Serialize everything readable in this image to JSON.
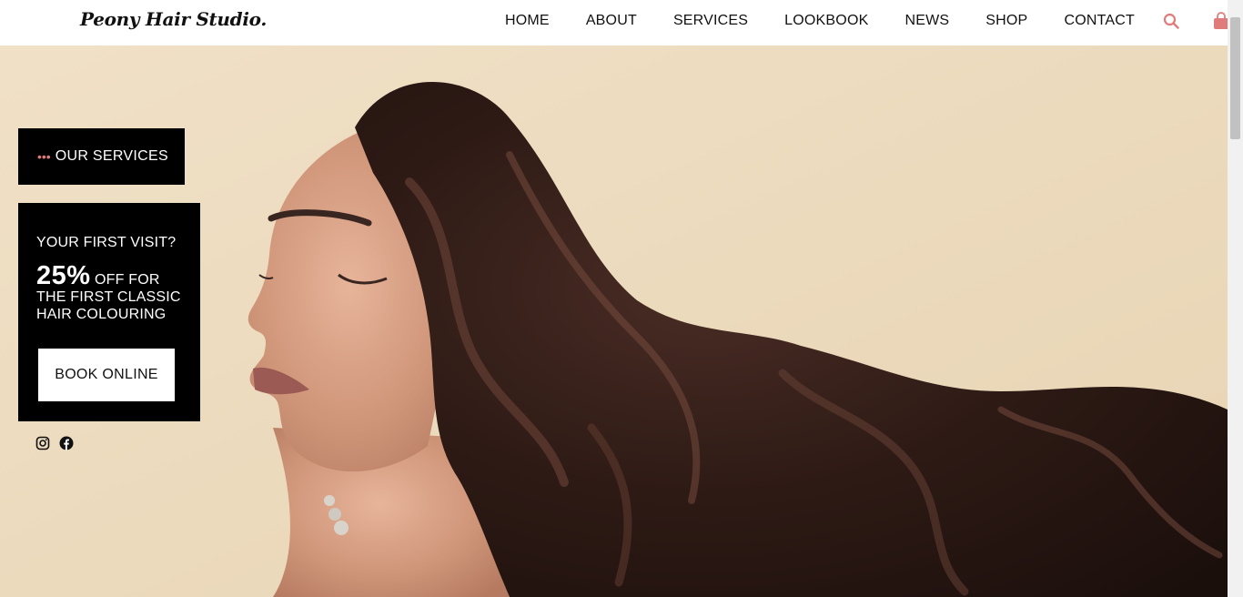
{
  "brand": {
    "name": "Peony Hair Studio."
  },
  "nav": {
    "items": [
      {
        "label": "HOME"
      },
      {
        "label": "ABOUT"
      },
      {
        "label": "SERVICES"
      },
      {
        "label": "LOOKBOOK"
      },
      {
        "label": "NEWS"
      },
      {
        "label": "SHOP"
      },
      {
        "label": "CONTACT"
      }
    ],
    "icons": [
      "search-icon",
      "shopping-bag-icon"
    ]
  },
  "sidebar": {
    "services_dots": "•••",
    "services_label": "OUR SERVICES"
  },
  "promo": {
    "question": "YOUR FIRST VISIT?",
    "percent": "25%",
    "off_text": "OFF FOR",
    "line2": "THE FIRST CLASSIC",
    "line3": "HAIR COLOURING",
    "button": "BOOK ONLINE"
  },
  "socials": [
    "instagram-icon",
    "facebook-icon"
  ],
  "colors": {
    "accent": "#e07b7b",
    "hero_background": "#eddcc1",
    "panel": "#000000"
  }
}
